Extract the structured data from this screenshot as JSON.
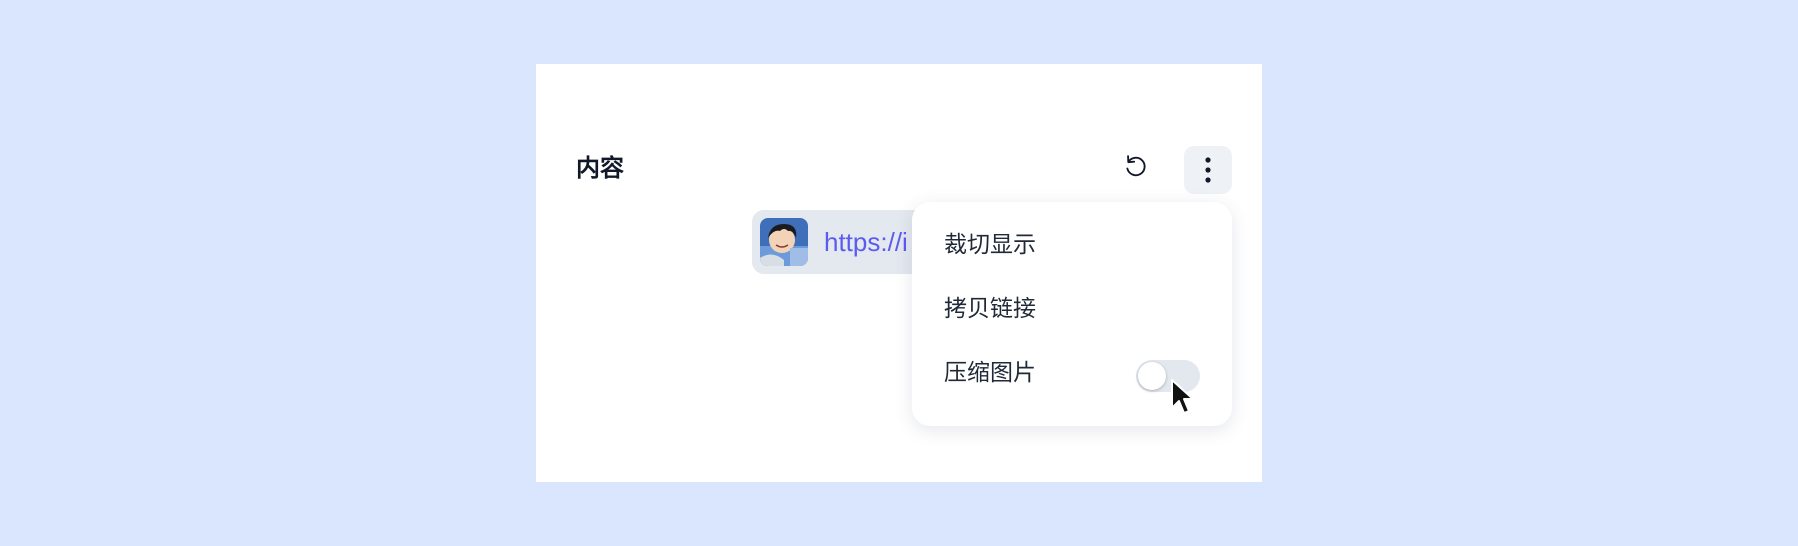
{
  "panel": {
    "title": "内容"
  },
  "toolbar": {
    "undo_icon": "undo-icon",
    "more_icon": "more-vertical-icon"
  },
  "link": {
    "text": "https://i",
    "color": "#5b5bf0"
  },
  "menu": {
    "items": [
      {
        "label": "裁切显示"
      },
      {
        "label": "拷贝链接"
      },
      {
        "label": "压缩图片",
        "toggle": false
      }
    ]
  },
  "colors": {
    "page_background": "#d9e6fd",
    "card_background": "#ffffff",
    "toggle_off": "#e3e8ef"
  }
}
